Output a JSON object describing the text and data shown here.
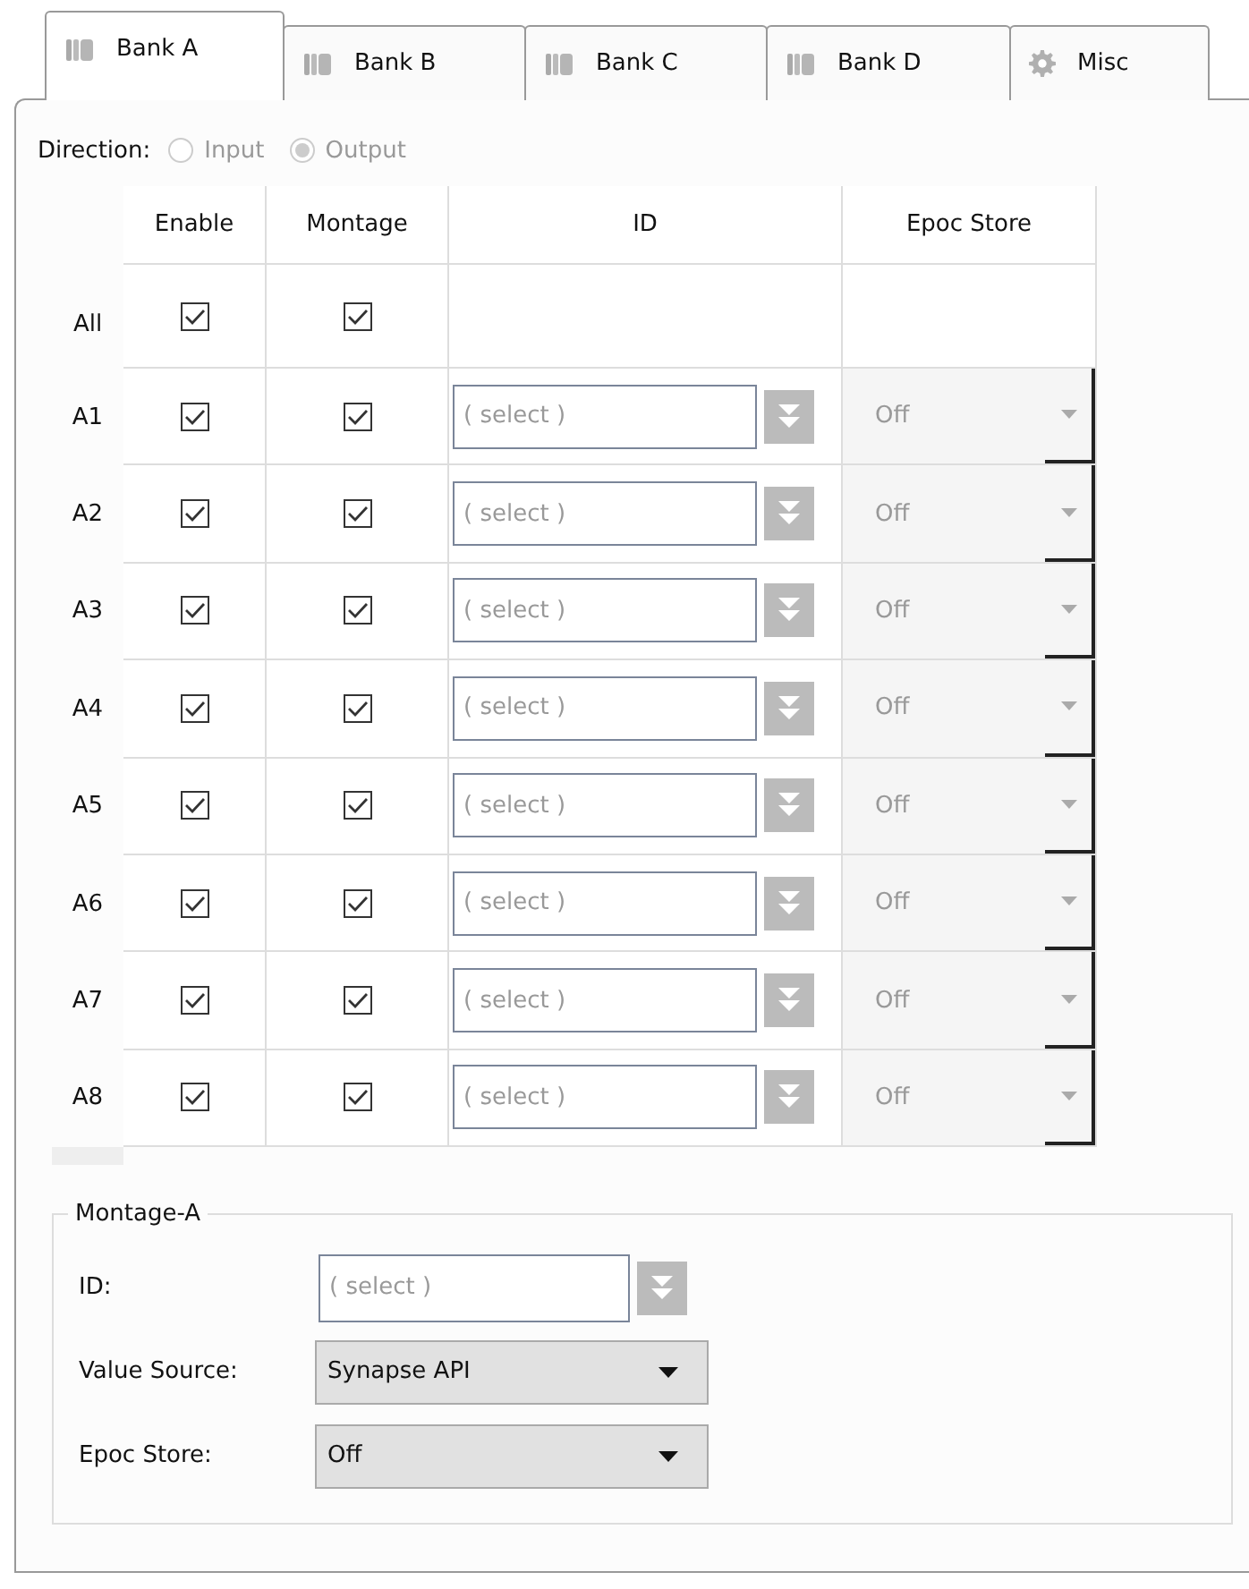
{
  "tabs": [
    {
      "label": "Bank A",
      "kind": "bank",
      "selected": true
    },
    {
      "label": "Bank B",
      "kind": "bank",
      "selected": false
    },
    {
      "label": "Bank C",
      "kind": "bank",
      "selected": false
    },
    {
      "label": "Bank D",
      "kind": "bank",
      "selected": false
    },
    {
      "label": "Misc",
      "kind": "misc",
      "selected": false
    }
  ],
  "direction": {
    "label": "Direction:",
    "disabled": true,
    "options": [
      {
        "label": "Input",
        "selected": false
      },
      {
        "label": "Output",
        "selected": true
      }
    ]
  },
  "grid": {
    "columns": [
      "Enable",
      "Montage",
      "ID",
      "Epoc Store"
    ],
    "all_row": {
      "label": "All",
      "enable": true,
      "montage": true
    },
    "rows": [
      {
        "label": "A1",
        "enable": true,
        "montage": true,
        "id": "( select )",
        "epoc": "Off",
        "epoc_disabled": true
      },
      {
        "label": "A2",
        "enable": true,
        "montage": true,
        "id": "( select )",
        "epoc": "Off",
        "epoc_disabled": true
      },
      {
        "label": "A3",
        "enable": true,
        "montage": true,
        "id": "( select )",
        "epoc": "Off",
        "epoc_disabled": true
      },
      {
        "label": "A4",
        "enable": true,
        "montage": true,
        "id": "( select )",
        "epoc": "Off",
        "epoc_disabled": true
      },
      {
        "label": "A5",
        "enable": true,
        "montage": true,
        "id": "( select )",
        "epoc": "Off",
        "epoc_disabled": true
      },
      {
        "label": "A6",
        "enable": true,
        "montage": true,
        "id": "( select )",
        "epoc": "Off",
        "epoc_disabled": true
      },
      {
        "label": "A7",
        "enable": true,
        "montage": true,
        "id": "( select )",
        "epoc": "Off",
        "epoc_disabled": true
      },
      {
        "label": "A8",
        "enable": true,
        "montage": true,
        "id": "( select )",
        "epoc": "Off",
        "epoc_disabled": true
      }
    ]
  },
  "montage": {
    "title": "Montage-A",
    "fields": [
      {
        "kind": "picker",
        "label": "ID:",
        "placeholder": "( select )"
      },
      {
        "kind": "dropdown",
        "label": "Value Source:",
        "value": "Synapse API"
      },
      {
        "kind": "dropdown",
        "label": "Epoc Store:",
        "value": "Off"
      }
    ]
  }
}
